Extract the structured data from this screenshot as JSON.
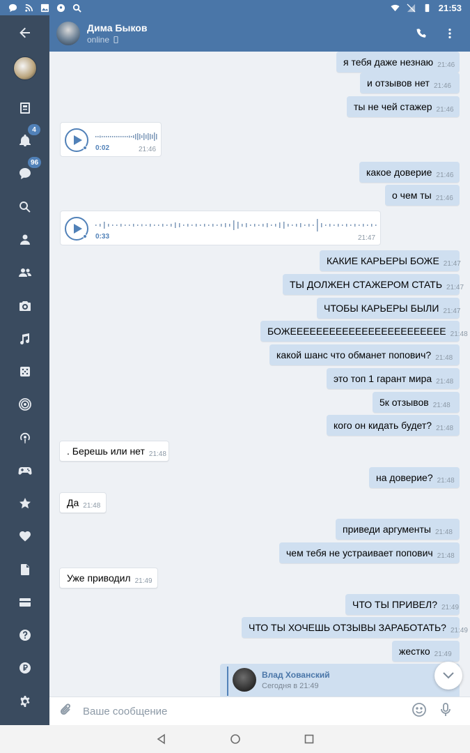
{
  "status_bar": {
    "time": "21:53"
  },
  "header": {
    "name": "Дима Быков",
    "status": "online"
  },
  "sidebar": {
    "notifications_badge": "4",
    "messages_badge": "96"
  },
  "messages": [
    {
      "text": "я тебя даже незнаю",
      "time": "21:46"
    },
    {
      "text": "и отзывов нет",
      "time": "21:46"
    },
    {
      "text": "ты не чей стажер",
      "time": "21:46"
    },
    {
      "text": "какое доверие",
      "time": "21:46"
    },
    {
      "text": "о чем ты",
      "time": "21:46"
    },
    {
      "text": "КАКИЕ КАРЬЕРЫ БОЖЕ",
      "time": "21:47"
    },
    {
      "text": "ТЫ ДОЛЖЕН СТАЖЕРОМ СТАТЬ",
      "time": "21:47"
    },
    {
      "text": "ЧТОБЫ КАРЬЕРЫ БЫЛИ",
      "time": "21:47"
    },
    {
      "text": "БОЖЕЕЕЕЕЕЕЕЕЕЕЕЕЕЕЕЕЕЕЕЕЕЕЕ",
      "time": "21:48"
    },
    {
      "text": "какой шанс что обманет попович?",
      "time": "21:48"
    },
    {
      "text": "это топ 1 гарант мира",
      "time": "21:48"
    },
    {
      "text": "5к отзывов",
      "time": "21:48"
    },
    {
      "text": "кого он кидать будет?",
      "time": "21:48"
    },
    {
      "text": ". Берешь или нет",
      "time": "21:48"
    },
    {
      "text": "на доверие?",
      "time": "21:48"
    },
    {
      "text": "Да",
      "time": "21:48"
    },
    {
      "text": "приведи аргументы",
      "time": "21:48"
    },
    {
      "text": "чем тебя не устраивает попович",
      "time": "21:48"
    },
    {
      "text": "Уже приводил",
      "time": "21:49"
    },
    {
      "text": "ЧТО ТЫ ПРИВЕЛ?",
      "time": "21:49"
    },
    {
      "text": "ЧТО ТЫ ХОЧЕШЬ ОТЗЫВЫ ЗАРАБОТАТЬ?",
      "time": "21:49"
    },
    {
      "text": "жестко",
      "time": "21:49"
    }
  ],
  "voice_messages": [
    {
      "duration": "0:02",
      "time": "21:46"
    },
    {
      "duration": "0:33",
      "time": "21:47"
    }
  ],
  "forwarded": {
    "author": "Влад Хованский",
    "when": "Сегодня в 21:49"
  },
  "composer": {
    "placeholder": "Ваше сообщение"
  }
}
